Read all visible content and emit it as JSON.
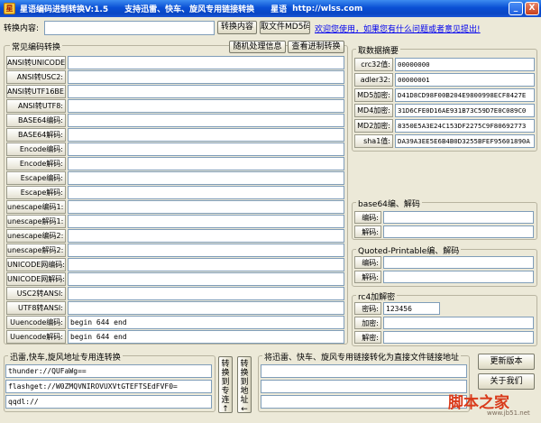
{
  "titlebar": {
    "app_name": "星语编码进制转换V:1.5",
    "subtitle": "支持迅雷、快车、旋风专用链接转换",
    "author": "星语",
    "url": "http://wlss.com",
    "minimize": "_",
    "close": "X"
  },
  "top": {
    "convert_label": "转换内容:",
    "convert_value": "",
    "convert_button": "转换内容",
    "md5_button": "取文件MD5码",
    "welcome_link": "欢迎您使用，如果您有什么问题或者意见提出!"
  },
  "encoding": {
    "title": "常见编码转换",
    "random_button": "随机处理信息",
    "view_button": "查看进制转换",
    "rows": [
      {
        "label": "ANSI转UNICODE:",
        "value": ""
      },
      {
        "label": "ANSI转USC2:",
        "value": ""
      },
      {
        "label": "ANSI转UTF16BE:",
        "value": ""
      },
      {
        "label": "ANSI转UTF8:",
        "value": ""
      },
      {
        "label": "BASE64编码:",
        "value": ""
      },
      {
        "label": "BASE64解码:",
        "value": ""
      },
      {
        "label": "Encode编码:",
        "value": ""
      },
      {
        "label": "Encode解码:",
        "value": ""
      },
      {
        "label": "Escape编码:",
        "value": ""
      },
      {
        "label": "Escape解码:",
        "value": ""
      },
      {
        "label": "unescape编码1:",
        "value": ""
      },
      {
        "label": "unescape解码1:",
        "value": ""
      },
      {
        "label": "unescape编码2:",
        "value": ""
      },
      {
        "label": "unescape解码2:",
        "value": ""
      },
      {
        "label": "UNICODE网编码:",
        "value": ""
      },
      {
        "label": "UNICODE网解码:",
        "value": ""
      },
      {
        "label": "USC2转ANSI:",
        "value": ""
      },
      {
        "label": "UTF8转ANSI:",
        "value": ""
      },
      {
        "label": "Uuencode编码:",
        "value": "begin 644  end"
      },
      {
        "label": "Uuencode解码:",
        "value": "begin 644  end"
      }
    ]
  },
  "digest": {
    "title": "取数据摘要",
    "rows": [
      {
        "label": "crc32值:",
        "value": "00000000"
      },
      {
        "label": "adler32:",
        "value": "00000001"
      },
      {
        "label": "MD5加密:",
        "value": "D41D8CD98F00B204E9800998ECF8427E"
      },
      {
        "label": "MD4加密:",
        "value": "31D6CFE0D16AE931B73C59D7E0C089C0"
      },
      {
        "label": "MD2加密:",
        "value": "8350E5A3E24C153DF2275C9F80692773"
      },
      {
        "label": "sha1值:",
        "value": "DA39A3EE5E6B4B0D3255BFEF95601890A"
      }
    ]
  },
  "base64": {
    "title": "base64编、解码",
    "rows": [
      {
        "label": "编码:",
        "value": ""
      },
      {
        "label": "解码:",
        "value": ""
      }
    ]
  },
  "qp": {
    "title": "Quoted-Printable编、解码",
    "rows": [
      {
        "label": "编码:",
        "value": ""
      },
      {
        "label": "解码:",
        "value": ""
      }
    ]
  },
  "rc4": {
    "title": "rc4加解密",
    "rows": [
      {
        "label": "密码:",
        "value": "123456"
      },
      {
        "label": "加密:",
        "value": ""
      },
      {
        "label": "解密:",
        "value": ""
      }
    ]
  },
  "thunder": {
    "title": "迅雷,快车,旋风地址专用连转换",
    "rows": [
      {
        "value": "thunder://QUFaWg=="
      },
      {
        "value": "flashget://W0ZMQVNIROVUXVtGTEFTSEdFVF0="
      },
      {
        "value": "qqdl://"
      }
    ],
    "to_special_button": "转换到专连↑",
    "to_address_button": "转换到地址←"
  },
  "direct": {
    "title": "将迅雷、快车、旋风专用链接转化为直接文件链接地址",
    "rows": [
      {
        "value": ""
      },
      {
        "value": ""
      },
      {
        "value": ""
      }
    ]
  },
  "side": {
    "update_button": "更新版本",
    "about_button": "关于我们"
  },
  "watermark": {
    "main": "脚本之家",
    "sub": "www.jb51.net"
  }
}
